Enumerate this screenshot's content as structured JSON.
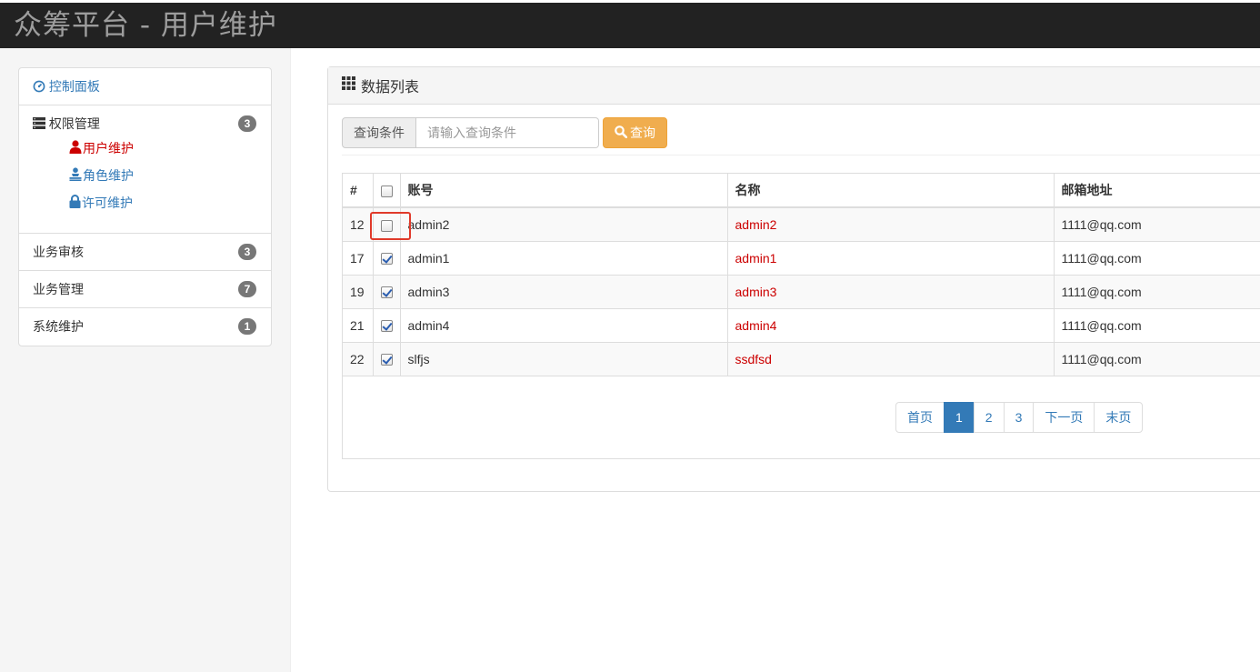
{
  "header": {
    "title": "众筹平台 - 用户维护"
  },
  "sidebar": {
    "dashboard": {
      "label": "控制面板",
      "icon": "dashboard-icon"
    },
    "permission": {
      "label": "权限管理",
      "badge": "3",
      "icon": "list-icon",
      "items": [
        {
          "label": "用户维护",
          "icon": "user-icon",
          "active": true
        },
        {
          "label": "角色维护",
          "icon": "role-icon"
        },
        {
          "label": "许可维护",
          "icon": "lock-icon"
        }
      ]
    },
    "groups": [
      {
        "label": "业务审核",
        "badge": "3"
      },
      {
        "label": "业务管理",
        "badge": "7"
      },
      {
        "label": "系统维护",
        "badge": "1"
      }
    ]
  },
  "panel": {
    "title": "数据列表",
    "search": {
      "addon": "查询条件",
      "placeholder": "请输入查询条件",
      "value": "",
      "button": "查询"
    },
    "table": {
      "headers": [
        "#",
        "",
        "账号",
        "名称",
        "邮箱地址"
      ],
      "rows": [
        {
          "id": "12",
          "checked": false,
          "account": "admin2",
          "name": "admin2",
          "email": "1111@qq.com"
        },
        {
          "id": "17",
          "checked": true,
          "account": "admin1",
          "name": "admin1",
          "email": "1111@qq.com"
        },
        {
          "id": "19",
          "checked": true,
          "account": "admin3",
          "name": "admin3",
          "email": "1111@qq.com"
        },
        {
          "id": "21",
          "checked": true,
          "account": "admin4",
          "name": "admin4",
          "email": "1111@qq.com"
        },
        {
          "id": "22",
          "checked": true,
          "account": "slfjs",
          "name": "ssdfsd",
          "email": "1111@qq.com"
        }
      ]
    },
    "pagination": {
      "first": "首页",
      "pages": [
        "1",
        "2",
        "3"
      ],
      "current": "1",
      "next": "下一页",
      "last": "末页"
    }
  },
  "colors": {
    "accent": "#337ab7",
    "active": "#cc0000",
    "warning": "#f0ad4e",
    "header": "#222222",
    "highlight": "#e03a2a"
  }
}
